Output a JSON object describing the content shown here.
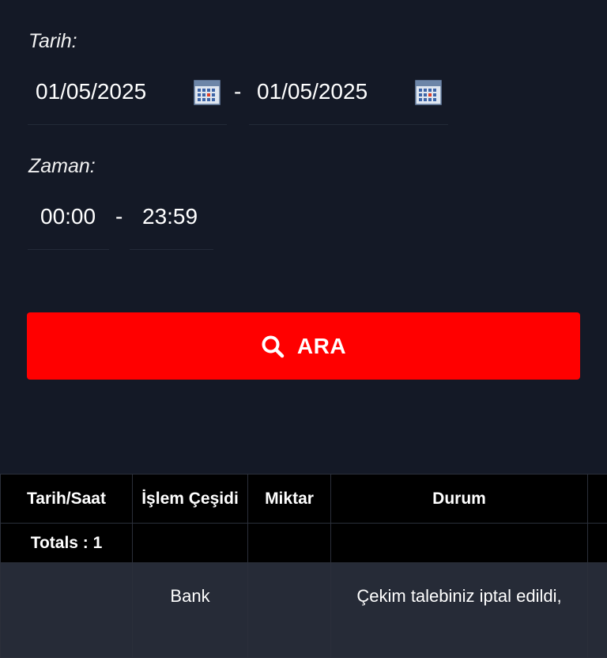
{
  "filters": {
    "date_label": "Tarih:",
    "date_from": "01/05/2025",
    "date_to": "01/05/2025",
    "date_separator": "-",
    "time_label": "Zaman:",
    "time_from": "00:00",
    "time_to": "23:59",
    "time_separator": "-"
  },
  "search_button": {
    "label": "ARA",
    "icon": "search-icon"
  },
  "table": {
    "headers": [
      "Tarih/Saat",
      "İşlem Çeşidi",
      "Miktar",
      "Durum",
      ""
    ],
    "totals_label": "Totals : 1",
    "rows": [
      {
        "datetime": "",
        "type": "Bank",
        "amount": "",
        "status": "Çekim talebiniz iptal edildi,"
      }
    ]
  },
  "colors": {
    "background": "#141926",
    "accent": "#ff0000",
    "table_header": "#000000",
    "row_bg": "#262b37"
  }
}
